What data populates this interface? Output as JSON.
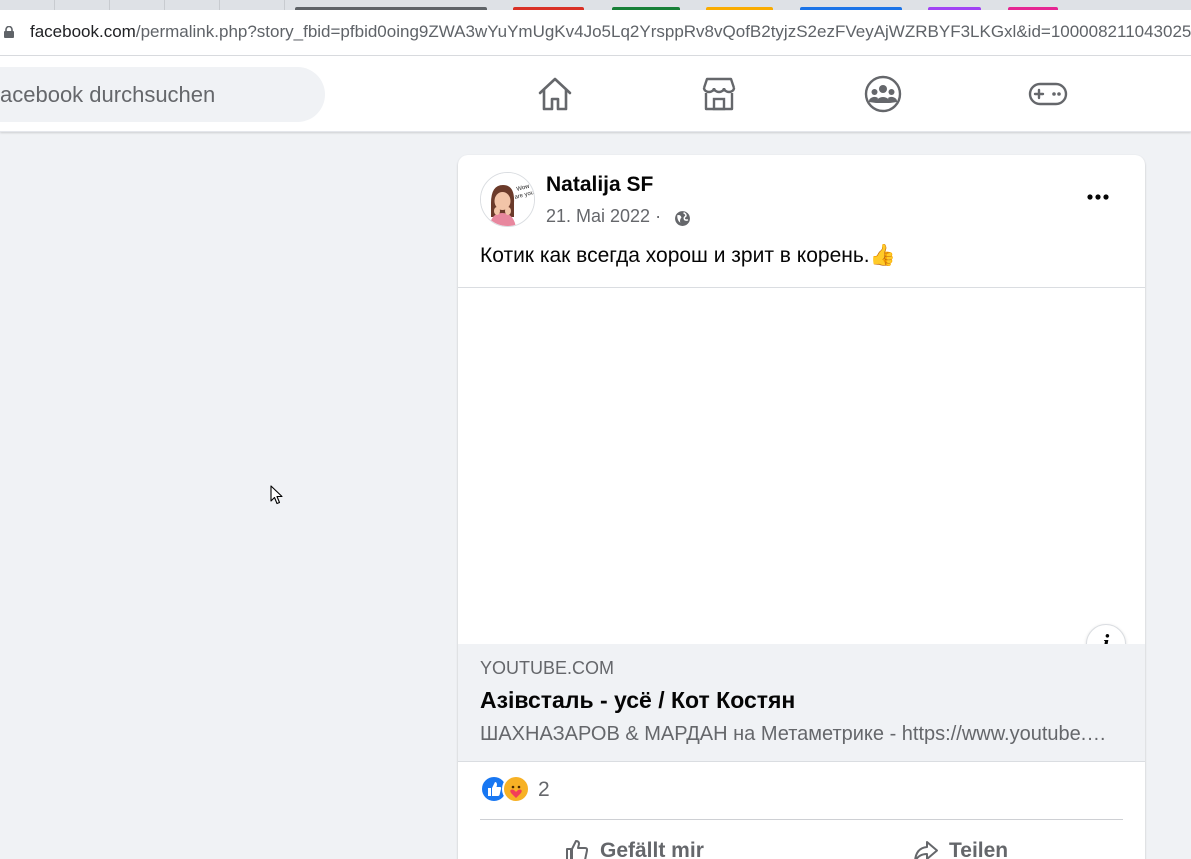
{
  "browser": {
    "url_host": "facebook.com",
    "url_path": "/permalink.php?story_fbid=pfbid0oing9ZWA3wYuYmUgKv4Jo5Lq2YrsppRv8vQofB2tyjzS2ezFVeyAjWZRBYF3LKGxl&id=100008211043025",
    "tab_colors": [
      "#5f6368",
      "#d93025",
      "#188038",
      "#f9ab00",
      "#1a73e8",
      "#a142f4",
      "#e52592"
    ]
  },
  "header": {
    "search_text": "acebook durchsuchen",
    "nav_icons": [
      "home-icon",
      "marketplace-icon",
      "groups-icon",
      "gaming-icon"
    ]
  },
  "post": {
    "author": "Natalija SF",
    "date": "21. Mai 2022 ·",
    "text": "Котик как всегда хорош и зрит в корень.👍",
    "link": {
      "domain": "YOUTUBE.COM",
      "title": "Азівсталь - усё / Кот Костян",
      "description": "ШАХНАЗАРОВ & МАРДАН на Метаметрике - https://www.youtube.com/..."
    },
    "info_icon": "i",
    "reaction_count": "2",
    "actions": {
      "like": "Gefällt mir",
      "share": "Teilen"
    }
  },
  "colors": {
    "fb_blue": "#1877f2",
    "background": "#f0f2f5",
    "secondary_text": "#65676b"
  }
}
